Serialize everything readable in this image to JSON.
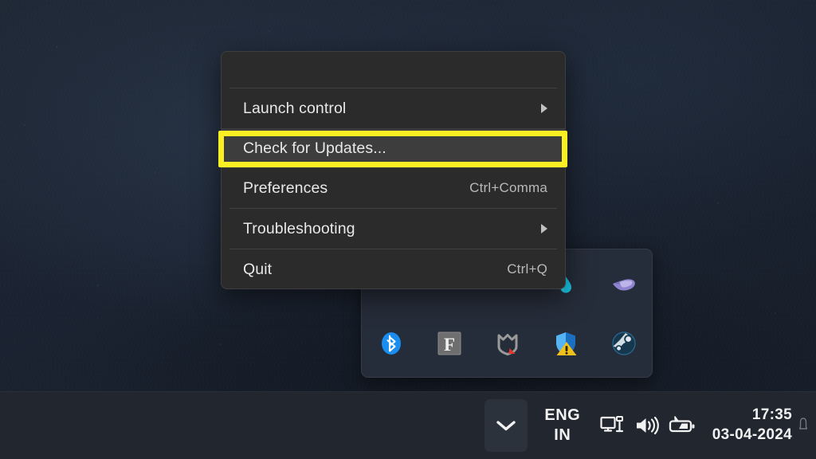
{
  "desktop": {
    "wallpaper_color": "#1d2533",
    "description": "dark navy textured wallpaper"
  },
  "context_menu": {
    "name": "tray-app-context-menu",
    "background_color": "#2b2b2b",
    "highlight_color": "#3d3d3d",
    "items": [
      {
        "label": "Launch control",
        "accel": "",
        "has_submenu": true,
        "highlighted": false
      },
      {
        "label": "Check for Updates...",
        "accel": "",
        "has_submenu": false,
        "highlighted": true
      },
      {
        "label": "Preferences",
        "accel": "Ctrl+Comma",
        "has_submenu": false,
        "highlighted": false
      },
      {
        "label": "Troubleshooting",
        "accel": "",
        "has_submenu": true,
        "highlighted": false
      },
      {
        "label": "Quit",
        "accel": "Ctrl+Q",
        "has_submenu": false,
        "highlighted": false
      }
    ]
  },
  "annotations": {
    "color": "#f9ef22",
    "highlight_box_target": "Check for Updates...",
    "arrow_target": "show-hidden-icons-chevron"
  },
  "tray_flyout": {
    "name": "hidden-icons-flyout",
    "background_color": "#262d3a",
    "row1": [
      {
        "name": "water-drop-icon",
        "title": "",
        "color": "#19c8e8"
      },
      {
        "name": "purple-app-icon",
        "title": "",
        "color": "#9b8fd6"
      }
    ],
    "row2": [
      {
        "name": "bluetooth-icon",
        "title": "Bluetooth",
        "color": "#1a8df0"
      },
      {
        "name": "fontbase-f-icon",
        "title": "F",
        "color": "#8b8b8b"
      },
      {
        "name": "malwarebytes-icon",
        "title": "",
        "color": "#9a9a9a"
      },
      {
        "name": "windows-security-icon",
        "title": "",
        "color": "#3aa0e8"
      },
      {
        "name": "steam-icon",
        "title": "",
        "color": "#1b3c56"
      }
    ]
  },
  "taskbar": {
    "background_color": "#21262f",
    "chevron": {
      "name": "show-hidden-icons-button",
      "glyph": "chevron-down"
    },
    "language": {
      "line1": "ENG",
      "line2": "IN"
    },
    "status_icons": [
      {
        "name": "network-ethernet-icon"
      },
      {
        "name": "volume-icon"
      },
      {
        "name": "battery-charging-icon"
      }
    ],
    "clock": {
      "time": "17:35",
      "date": "03-04-2024"
    }
  }
}
